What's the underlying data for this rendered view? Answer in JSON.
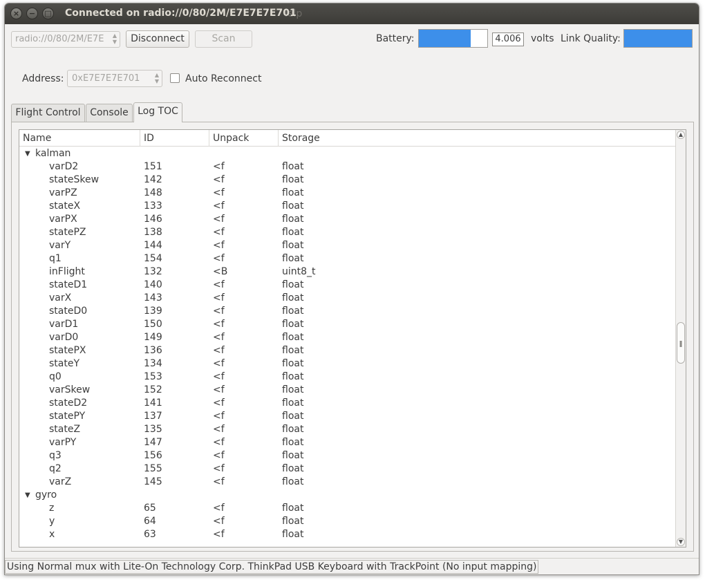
{
  "window": {
    "title": "Connected on radio://0/80/2M/E7E7E7E701",
    "title_ghost": "lelp",
    "controls": {
      "close": "×",
      "minimize": "−",
      "maximize": "□"
    }
  },
  "toolbar": {
    "uri_value": "radio://0/80/2M/E7E7E7E701",
    "uri_visible": "radio://0/80/2M/E7E",
    "disconnect_label": "Disconnect",
    "scan_label": "Scan",
    "battery_label": "Battery:",
    "battery_level_fraction": 0.76,
    "voltage_value": "4.006",
    "volts_label": "volts",
    "link_quality_label": "Link Quality:",
    "link_quality_fraction": 1.0
  },
  "address": {
    "label": "Address:",
    "value": "0xE7E7E7E701",
    "auto_reconnect_label": "Auto Reconnect",
    "auto_reconnect_checked": false
  },
  "tabs": [
    {
      "label": "Flight Control",
      "active": false
    },
    {
      "label": "Console",
      "active": false
    },
    {
      "label": "Log TOC",
      "active": true
    }
  ],
  "log_toc": {
    "columns": [
      "Name",
      "ID",
      "Unpack",
      "Storage"
    ],
    "groups": [
      {
        "name": "kalman",
        "expanded": true,
        "items": [
          {
            "name": "varD2",
            "id": "151",
            "unpack": "<f",
            "storage": "float"
          },
          {
            "name": "stateSkew",
            "id": "142",
            "unpack": "<f",
            "storage": "float"
          },
          {
            "name": "varPZ",
            "id": "148",
            "unpack": "<f",
            "storage": "float"
          },
          {
            "name": "stateX",
            "id": "133",
            "unpack": "<f",
            "storage": "float"
          },
          {
            "name": "varPX",
            "id": "146",
            "unpack": "<f",
            "storage": "float"
          },
          {
            "name": "statePZ",
            "id": "138",
            "unpack": "<f",
            "storage": "float"
          },
          {
            "name": "varY",
            "id": "144",
            "unpack": "<f",
            "storage": "float"
          },
          {
            "name": "q1",
            "id": "154",
            "unpack": "<f",
            "storage": "float"
          },
          {
            "name": "inFlight",
            "id": "132",
            "unpack": "<B",
            "storage": "uint8_t"
          },
          {
            "name": "stateD1",
            "id": "140",
            "unpack": "<f",
            "storage": "float"
          },
          {
            "name": "varX",
            "id": "143",
            "unpack": "<f",
            "storage": "float"
          },
          {
            "name": "stateD0",
            "id": "139",
            "unpack": "<f",
            "storage": "float"
          },
          {
            "name": "varD1",
            "id": "150",
            "unpack": "<f",
            "storage": "float"
          },
          {
            "name": "varD0",
            "id": "149",
            "unpack": "<f",
            "storage": "float"
          },
          {
            "name": "statePX",
            "id": "136",
            "unpack": "<f",
            "storage": "float"
          },
          {
            "name": "stateY",
            "id": "134",
            "unpack": "<f",
            "storage": "float"
          },
          {
            "name": "q0",
            "id": "153",
            "unpack": "<f",
            "storage": "float"
          },
          {
            "name": "varSkew",
            "id": "152",
            "unpack": "<f",
            "storage": "float"
          },
          {
            "name": "stateD2",
            "id": "141",
            "unpack": "<f",
            "storage": "float"
          },
          {
            "name": "statePY",
            "id": "137",
            "unpack": "<f",
            "storage": "float"
          },
          {
            "name": "stateZ",
            "id": "135",
            "unpack": "<f",
            "storage": "float"
          },
          {
            "name": "varPY",
            "id": "147",
            "unpack": "<f",
            "storage": "float"
          },
          {
            "name": "q3",
            "id": "156",
            "unpack": "<f",
            "storage": "float"
          },
          {
            "name": "q2",
            "id": "155",
            "unpack": "<f",
            "storage": "float"
          },
          {
            "name": "varZ",
            "id": "145",
            "unpack": "<f",
            "storage": "float"
          }
        ]
      },
      {
        "name": "gyro",
        "expanded": true,
        "items": [
          {
            "name": "z",
            "id": "65",
            "unpack": "<f",
            "storage": "float"
          },
          {
            "name": "y",
            "id": "64",
            "unpack": "<f",
            "storage": "float"
          },
          {
            "name": "x",
            "id": "63",
            "unpack": "<f",
            "storage": "float"
          }
        ]
      }
    ]
  },
  "status_bar": {
    "message": "Using Normal mux with Lite-On Technology Corp. ThinkPad USB Keyboard with TrackPoint (No input mapping)"
  },
  "colors": {
    "accent_fill": "#3d8fea",
    "titlebar": "#3c3b37",
    "window_bg": "#f2f1f0"
  }
}
